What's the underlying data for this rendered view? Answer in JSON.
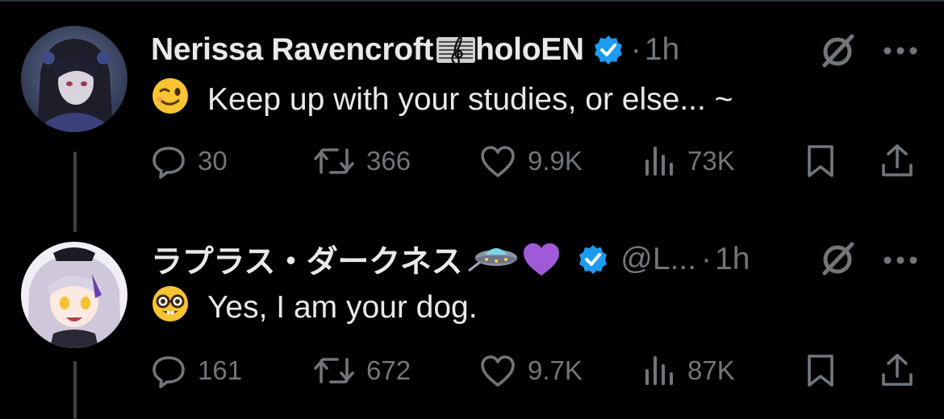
{
  "colors": {
    "background": "#000000",
    "text": "#e7e9ea",
    "muted": "#71767b",
    "verified": "#1d9bf0",
    "thread_line": "#3e4144"
  },
  "tweets": [
    {
      "display_name": "Nerissa Ravencroft",
      "name_suffix": "holoEN",
      "name_emoji": "musical-staff-emoji",
      "handle": "",
      "separator": "·",
      "time": "1h",
      "text": "Keep up with your studies, or else... ~",
      "text_emoji": "winking-face-emoji",
      "stats": {
        "replies": "30",
        "reposts": "366",
        "likes": "9.9K",
        "views": "73K"
      }
    },
    {
      "display_name": "ラプラス・ダークネス",
      "name_suffix": "",
      "name_emoji": "ufo-emoji purple-heart-emoji",
      "handle": "@L...",
      "separator": "·",
      "time": "1h",
      "text": "Yes, I am your dog.",
      "text_emoji": "nerd-face-emoji",
      "stats": {
        "replies": "161",
        "reposts": "672",
        "likes": "9.7K",
        "views": "87K"
      }
    }
  ]
}
